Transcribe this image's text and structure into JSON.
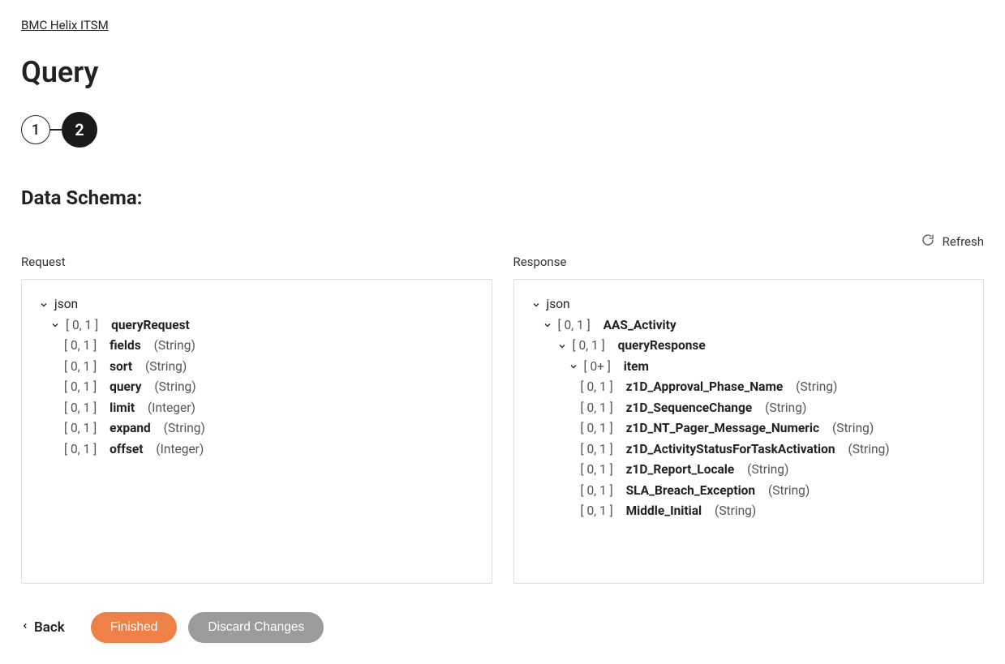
{
  "breadcrumb": {
    "label": "BMC Helix ITSM"
  },
  "page": {
    "title": "Query"
  },
  "stepper": {
    "step1": "1",
    "step2": "2"
  },
  "section": {
    "title": "Data Schema:"
  },
  "refresh": {
    "label": "Refresh"
  },
  "columns": {
    "request": "Request",
    "response": "Response"
  },
  "request_tree": {
    "root": "json",
    "queryRequest": {
      "card": "[ 0, 1 ]",
      "name": "queryRequest"
    },
    "fields": {
      "card": "[ 0, 1 ]",
      "name": "fields",
      "type": "(String)"
    },
    "sort": {
      "card": "[ 0, 1 ]",
      "name": "sort",
      "type": "(String)"
    },
    "query": {
      "card": "[ 0, 1 ]",
      "name": "query",
      "type": "(String)"
    },
    "limit": {
      "card": "[ 0, 1 ]",
      "name": "limit",
      "type": "(Integer)"
    },
    "expand": {
      "card": "[ 0, 1 ]",
      "name": "expand",
      "type": "(String)"
    },
    "offset": {
      "card": "[ 0, 1 ]",
      "name": "offset",
      "type": "(Integer)"
    }
  },
  "response_tree": {
    "root": "json",
    "aas": {
      "card": "[ 0, 1 ]",
      "name": "AAS_Activity"
    },
    "qresp": {
      "card": "[ 0, 1 ]",
      "name": "queryResponse"
    },
    "item": {
      "card": "[ 0+ ]",
      "name": "item"
    },
    "f1": {
      "card": "[ 0, 1 ]",
      "name": "z1D_Approval_Phase_Name",
      "type": "(String)"
    },
    "f2": {
      "card": "[ 0, 1 ]",
      "name": "z1D_SequenceChange",
      "type": "(String)"
    },
    "f3": {
      "card": "[ 0, 1 ]",
      "name": "z1D_NT_Pager_Message_Numeric",
      "type": "(String)"
    },
    "f4": {
      "card": "[ 0, 1 ]",
      "name": "z1D_ActivityStatusForTaskActivation",
      "type": "(String)"
    },
    "f5": {
      "card": "[ 0, 1 ]",
      "name": "z1D_Report_Locale",
      "type": "(String)"
    },
    "f6": {
      "card": "[ 0, 1 ]",
      "name": "SLA_Breach_Exception",
      "type": "(String)"
    },
    "f7": {
      "card": "[ 0, 1 ]",
      "name": "Middle_Initial",
      "type": "(String)"
    }
  },
  "footer": {
    "back": "Back",
    "finished": "Finished",
    "discard": "Discard Changes"
  }
}
